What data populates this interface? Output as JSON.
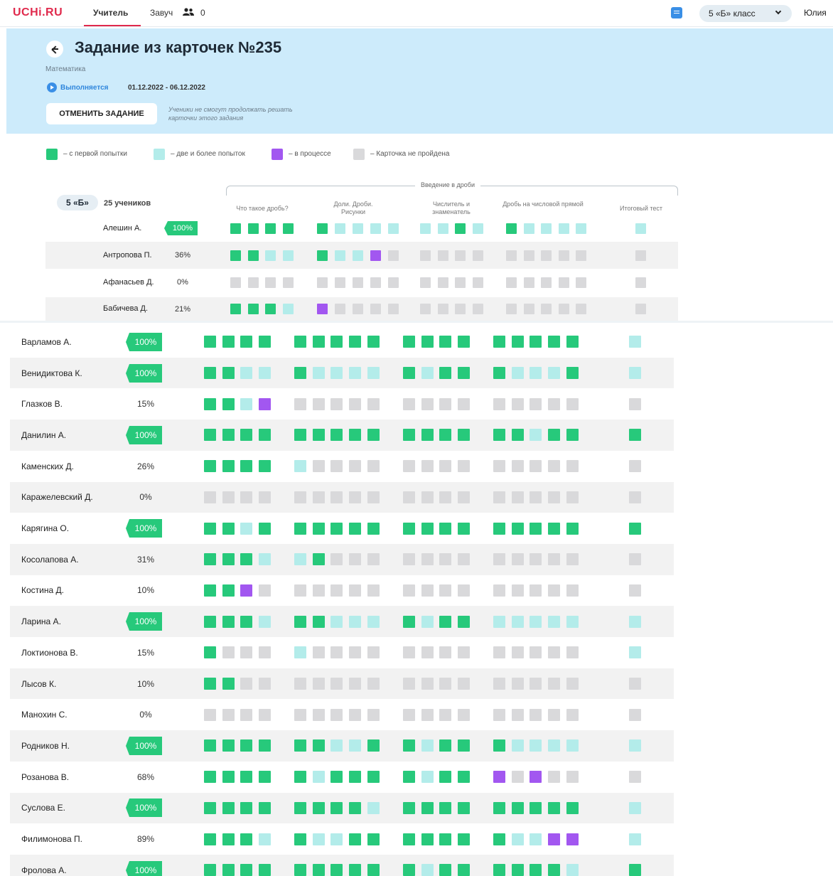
{
  "nav": {
    "logo": "UCHi.RU",
    "tabs": [
      "Учитель",
      "Завуч"
    ],
    "count": "0",
    "class_select": "5 «Б» класс",
    "user": "Юлия"
  },
  "header": {
    "title": "Задание из карточек №235",
    "subject": "Математика",
    "status": "Выполняется",
    "dates": "01.12.2022 - 06.12.2022",
    "cancel_button": "ОТМЕНИТЬ ЗАДАНИЕ",
    "cancel_note": "Ученики не смогут продолжать решать карточки этого задания"
  },
  "legend": [
    {
      "label": "– с первой попытки",
      "color": "#27c97b"
    },
    {
      "label": "– две и более попыток",
      "color": "#b3ecea"
    },
    {
      "label": "– в процессе",
      "color": "#a257f0"
    },
    {
      "label": "– Карточка не пройдена",
      "color": "#d9d9db"
    }
  ],
  "colors": {
    "G": "#27c97b",
    "L": "#b3ecea",
    "P": "#a257f0",
    "X": "#d9d9db"
  },
  "table": {
    "group_label": "Введение в дроби",
    "class_label": "5 «Б»",
    "students_count": "25 учеников",
    "columns": [
      "Что такое дробь?",
      "Доли. Дроби. Рисунки",
      "Числитель и знаменатель",
      "Дробь на числовой прямой",
      "Итоговый тест"
    ]
  },
  "students": [
    {
      "name": "Алешин А.",
      "percent": "100%",
      "cells": [
        "GGGG",
        "GLLLL",
        "LLGL",
        "GLLLL",
        "L"
      ]
    },
    {
      "name": "Антропова П.",
      "percent": "36%",
      "cells": [
        "GGLL",
        "GLLPX",
        "XXXX",
        "XXXXX",
        "X"
      ]
    },
    {
      "name": "Афанасьев Д.",
      "percent": "0%",
      "cells": [
        "XXXX",
        "XXXXX",
        "XXXX",
        "XXXXX",
        "X"
      ]
    },
    {
      "name": "Бабичева Д.",
      "percent": "21%",
      "cells": [
        "GGGL",
        "PXXXX",
        "XXXX",
        "XXXXX",
        "X"
      ]
    },
    {
      "name": "Варламов А.",
      "percent": "100%",
      "cells": [
        "GGGG",
        "GGGGG",
        "GGGG",
        "GGGGG",
        "L"
      ]
    },
    {
      "name": "Венидиктова К.",
      "percent": "100%",
      "cells": [
        "GGLL",
        "GLLLL",
        "GLGG",
        "GLLLG",
        "L"
      ]
    },
    {
      "name": "Глазков В.",
      "percent": "15%",
      "cells": [
        "GGLP",
        "XXXXX",
        "XXXX",
        "XXXXX",
        "X"
      ]
    },
    {
      "name": "Данилин А.",
      "percent": "100%",
      "cells": [
        "GGGG",
        "GGGGG",
        "GGGG",
        "GGLGG",
        "G"
      ]
    },
    {
      "name": "Каменских Д.",
      "percent": "26%",
      "cells": [
        "GGGG",
        "LXXXX",
        "XXXX",
        "XXXXX",
        "X"
      ]
    },
    {
      "name": "Каражелевский Д.",
      "percent": "0%",
      "cells": [
        "XXXX",
        "XXXXX",
        "XXXX",
        "XXXXX",
        "X"
      ]
    },
    {
      "name": "Карягина О.",
      "percent": "100%",
      "cells": [
        "GGLG",
        "GGGGG",
        "GGGG",
        "GGGGG",
        "G"
      ]
    },
    {
      "name": "Косолапова А.",
      "percent": "31%",
      "cells": [
        "GGGL",
        "LGXXX",
        "XXXX",
        "XXXXX",
        "X"
      ]
    },
    {
      "name": "Костина Д.",
      "percent": "10%",
      "cells": [
        "GGPX",
        "XXXXX",
        "XXXX",
        "XXXXX",
        "X"
      ]
    },
    {
      "name": "Ларина А.",
      "percent": "100%",
      "cells": [
        "GGGL",
        "GGLLL",
        "GLGG",
        "LLLLL",
        "L"
      ]
    },
    {
      "name": "Локтионова В.",
      "percent": "15%",
      "cells": [
        "GXXX",
        "LXXXX",
        "XXXX",
        "XXXXX",
        "L"
      ]
    },
    {
      "name": "Лысов К.",
      "percent": "10%",
      "cells": [
        "GGXX",
        "XXXXX",
        "XXXX",
        "XXXXX",
        "X"
      ]
    },
    {
      "name": "Манохин С.",
      "percent": "0%",
      "cells": [
        "XXXX",
        "XXXXX",
        "XXXX",
        "XXXXX",
        "X"
      ]
    },
    {
      "name": "Родников Н.",
      "percent": "100%",
      "cells": [
        "GGGG",
        "GGLLG",
        "GLGG",
        "GLLLL",
        "L"
      ]
    },
    {
      "name": "Розанова В.",
      "percent": "68%",
      "cells": [
        "GGGG",
        "GLGGG",
        "GLGG",
        "PXPXX",
        "X"
      ]
    },
    {
      "name": "Суслова Е.",
      "percent": "100%",
      "cells": [
        "GGGG",
        "GGGGL",
        "GGGG",
        "GGGGG",
        "L"
      ]
    },
    {
      "name": "Филимонова П.",
      "percent": "89%",
      "cells": [
        "GGGL",
        "GLLGG",
        "GGGG",
        "GLLPP",
        "L"
      ]
    },
    {
      "name": "Фролова А.",
      "percent": "100%",
      "cells": [
        "GGGG",
        "GGGGG",
        "GLGG",
        "GGGGL",
        "G"
      ]
    }
  ]
}
